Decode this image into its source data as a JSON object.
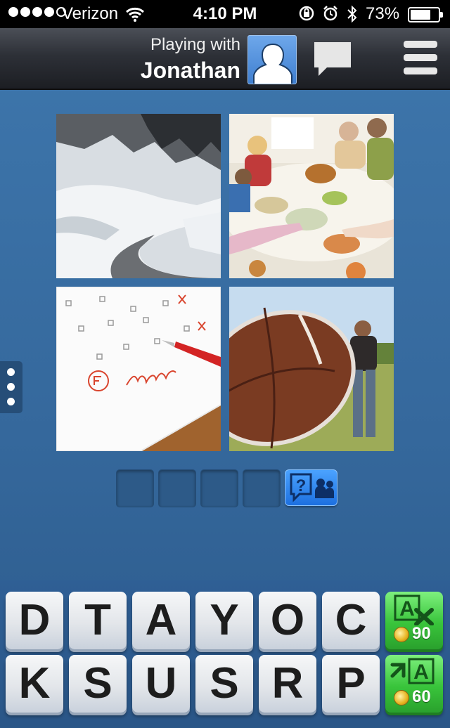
{
  "status_bar": {
    "carrier": "Verizon",
    "time": "4:10 PM",
    "battery": "73%",
    "battery_level": 0.73
  },
  "header": {
    "playing_with_label": "Playing with",
    "partner_name": "Jonathan"
  },
  "puzzle": {
    "photos": [
      {
        "icon": "snowy-mountain-road-photo"
      },
      {
        "icon": "family-dinner-photo"
      },
      {
        "icon": "failed-exam-photo"
      },
      {
        "icon": "football-throw-photo"
      }
    ],
    "answer_slots": 4
  },
  "keyboard": {
    "row1": [
      "D",
      "T",
      "A",
      "Y",
      "O",
      "C"
    ],
    "row2": [
      "K",
      "S",
      "U",
      "S",
      "R",
      "P"
    ],
    "remove_letters": {
      "icon": "remove-letters-icon",
      "price": "90"
    },
    "reveal_letter": {
      "icon": "reveal-letter-icon",
      "price": "60"
    }
  },
  "colors": {
    "background": "#3e77ad",
    "power_green": "#39c43b",
    "ask_blue": "#1d70e0"
  }
}
